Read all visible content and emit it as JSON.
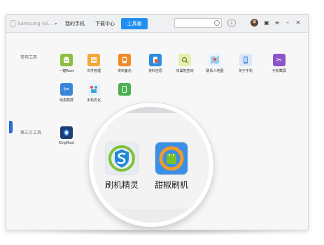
{
  "titlebar": {
    "device_name": "Samsung S4...",
    "tabs": [
      {
        "label": "我的手机"
      },
      {
        "label": "下载中心"
      },
      {
        "label": "工具箱"
      }
    ],
    "active_tab": "工具箱",
    "search_placeholder": ""
  },
  "sections": {
    "common_tools": {
      "label": "常用工具",
      "items": [
        {
          "label": "一键Root",
          "icon": "android-root-icon",
          "color": "#8cbf3f"
        },
        {
          "label": "文件管理",
          "icon": "folder-icon",
          "color": "#f2a93b"
        },
        {
          "label": "资料备份",
          "icon": "backup-icon",
          "color": "#f08a24"
        },
        {
          "label": "资料还原",
          "icon": "restore-icon",
          "color": "#e85a2a"
        },
        {
          "label": "归属地查询",
          "icon": "location-search-icon",
          "color": "#cde08a"
        },
        {
          "label": "联系人地图",
          "icon": "contacts-map-icon",
          "color": "#6aa9e8"
        },
        {
          "label": "关于手机",
          "icon": "phone-info-icon",
          "color": "#4a86d9"
        },
        {
          "label": "手机截屏",
          "icon": "scissors-icon",
          "color": "#8d53c9"
        },
        {
          "label": "动态截屏",
          "icon": "scissors-icon",
          "color": "#3a86d9"
        },
        {
          "label": "手机优化",
          "icon": "optimize-icon",
          "color": "#3fa2d6"
        },
        {
          "label": "",
          "icon": "phone-transfer-icon",
          "color": "#4caf50"
        }
      ]
    },
    "third_party_tools": {
      "label": "第三方工具",
      "items": [
        {
          "label": "KingRoot",
          "icon": "kingroot-icon",
          "color": "#1f3d73"
        }
      ]
    }
  },
  "magnified": {
    "items": [
      {
        "label": "刷机精灵",
        "icon": "shield-s-icon"
      },
      {
        "label": "甜椒刷机",
        "icon": "android-refresh-icon"
      }
    ]
  },
  "colors": {
    "accent": "#1f8ff2"
  }
}
